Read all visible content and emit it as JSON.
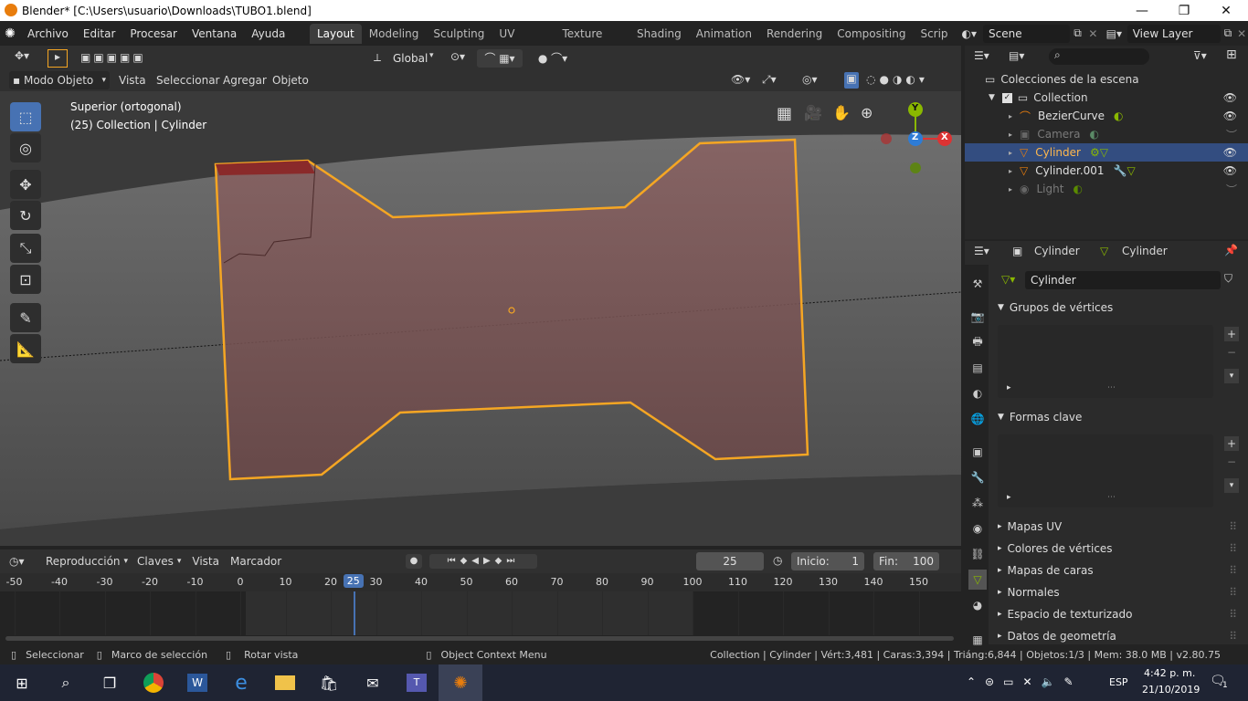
{
  "window": {
    "title": "Blender* [C:\\Users\\usuario\\Downloads\\TUBO1.blend]",
    "minimize": "—",
    "maximize": "❐",
    "close": "✕"
  },
  "menu": [
    "Archivo",
    "Editar",
    "Procesar",
    "Ventana",
    "Ayuda"
  ],
  "workspaces": [
    "Layout",
    "Modeling",
    "Sculpting",
    "UV Editing",
    "Texture Paint",
    "Shading",
    "Animation",
    "Rendering",
    "Compositing",
    "Scrip"
  ],
  "scene": "Scene",
  "view_layer": "View Layer",
  "viewport": {
    "transform_orientation": "Global",
    "mode": "Modo Objeto",
    "menus": [
      "Vista",
      "Seleccionar",
      "Agregar",
      "Objeto"
    ],
    "view_name": "Superior (ortogonal)",
    "context": "(25) Collection | Cylinder",
    "gizmo": {
      "y": "Y",
      "z": "Z",
      "x": "X"
    }
  },
  "outliner": {
    "root": "Colecciones de la escena",
    "collection": "Collection",
    "items": [
      {
        "name": "BezierCurve",
        "selected": false,
        "dim": false
      },
      {
        "name": "Camera",
        "selected": false,
        "dim": true
      },
      {
        "name": "Cylinder",
        "selected": true,
        "dim": false
      },
      {
        "name": "Cylinder.001",
        "selected": false,
        "dim": false
      },
      {
        "name": "Light",
        "selected": false,
        "dim": true
      }
    ]
  },
  "properties": {
    "object": "Cylinder",
    "data": "Cylinder",
    "mesh_name": "Cylinder",
    "panels_open": [
      "Grupos de vértices",
      "Formas clave"
    ],
    "panels_closed": [
      "Mapas UV",
      "Colores de vértices",
      "Mapas de caras",
      "Normales",
      "Espacio de texturizado",
      "Datos de geometría"
    ]
  },
  "timeline": {
    "menus": [
      "Reproducción",
      "Claves",
      "Vista",
      "Marcador"
    ],
    "current_frame": "25",
    "start_label": "Inicio:",
    "start": "1",
    "end_label": "Fin:",
    "end": "100",
    "ticks": [
      "-50",
      "-40",
      "-30",
      "-20",
      "-10",
      "0",
      "10",
      "20",
      "25",
      "30",
      "40",
      "50",
      "60",
      "70",
      "80",
      "90",
      "100",
      "110",
      "120",
      "130",
      "140",
      "150"
    ]
  },
  "status": {
    "select": "Seleccionar",
    "box": "Marco de selección",
    "rotate": "Rotar vista",
    "context_menu": "Object Context Menu",
    "stats": "Collection | Cylinder | Vért:3,481 | Caras:3,394 | Triáng:6,844 | Objetos:1/3 | Mem: 38.0 MB | v2.80.75"
  },
  "taskbar": {
    "lang": "ESP",
    "time": "4:42 p. m.",
    "date": "21/10/2019",
    "notif": "1"
  },
  "colors": {
    "accent": "#4772b3",
    "selection": "#f5a623",
    "bg": "#3a3a3a"
  }
}
